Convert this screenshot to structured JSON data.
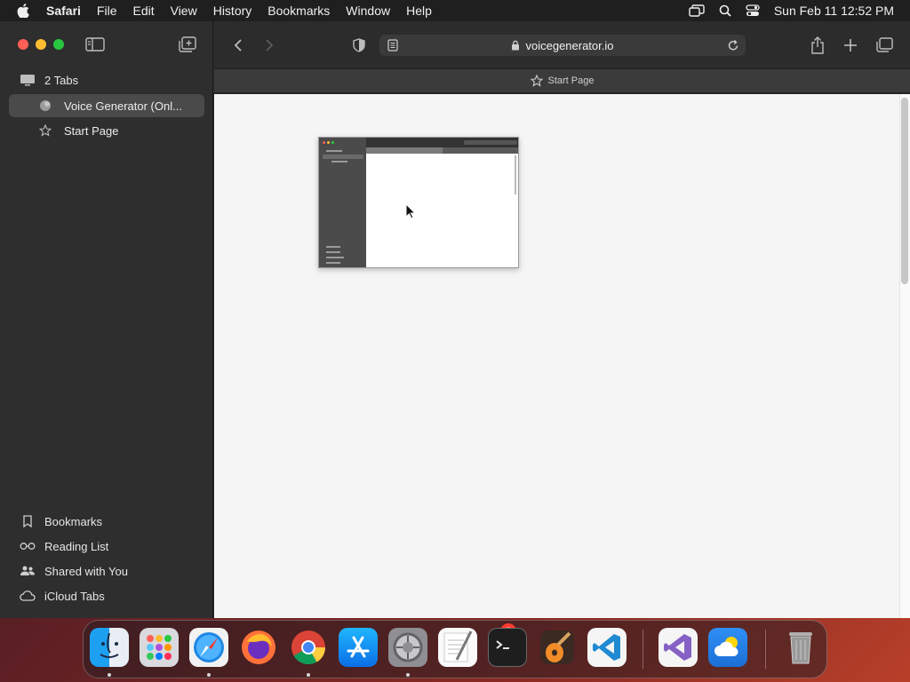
{
  "menubar": {
    "app_name": "Safari",
    "items": [
      "File",
      "Edit",
      "View",
      "History",
      "Bookmarks",
      "Window",
      "Help"
    ],
    "clock": "Sun Feb 11  12:52 PM"
  },
  "sidebar": {
    "tabs_header": "2 Tabs",
    "tabs": [
      {
        "label": "Voice Generator (Onl...",
        "selected": true
      },
      {
        "label": "Start Page",
        "selected": false
      }
    ],
    "bottom": [
      {
        "label": "Bookmarks",
        "icon": "bookmark-icon"
      },
      {
        "label": "Reading List",
        "icon": "glasses-icon"
      },
      {
        "label": "Shared with You",
        "icon": "people-icon"
      },
      {
        "label": "iCloud Tabs",
        "icon": "cloud-icon"
      }
    ]
  },
  "toolbar": {
    "url": "voicegenerator.io"
  },
  "tabbar": {
    "label": "Start Page"
  },
  "dock": {
    "apps": [
      "Finder",
      "Launchpad",
      "Safari",
      "Firefox",
      "Chrome",
      "App Store",
      "System Settings",
      "TextEdit",
      "Terminal",
      "GarageBand",
      "VS Code",
      "Visual Studio",
      "Weather",
      "Trash"
    ],
    "settings_badge": "2"
  },
  "colors": {
    "accent_red": "#fe5f57",
    "accent_yellow": "#febc2e",
    "accent_green": "#28c840",
    "badge": "#ff3b30"
  }
}
